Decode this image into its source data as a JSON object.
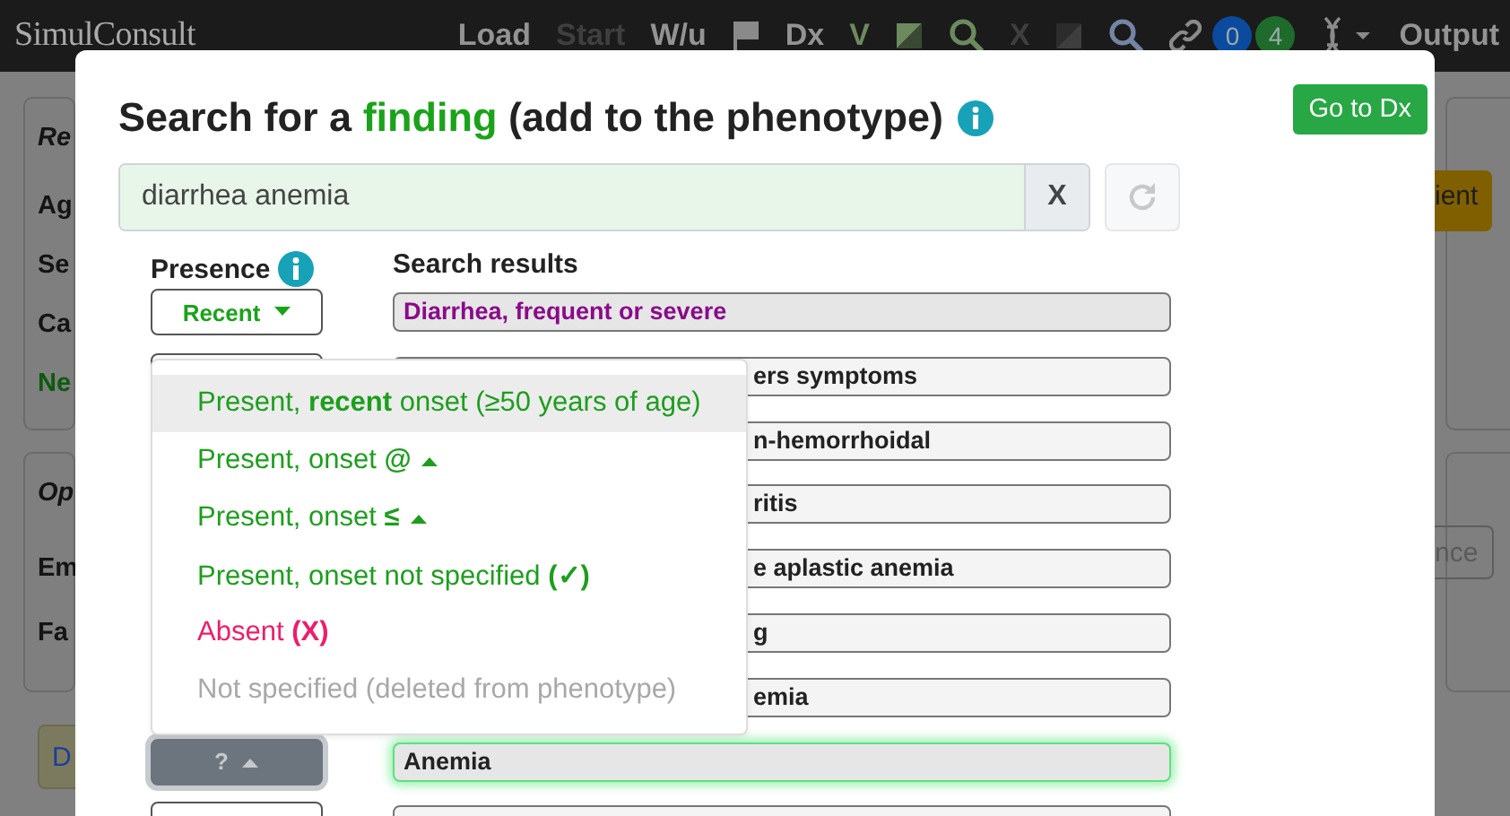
{
  "navbar": {
    "logo": "SimulConsult",
    "load": {
      "label": "Load",
      "disabled": false
    },
    "start": {
      "label": "Start",
      "disabled": true
    },
    "wu": {
      "label": "W/u",
      "disabled": false
    },
    "dx": {
      "label": "Dx",
      "disabled": false
    },
    "v": {
      "label": "V",
      "disabled": false
    },
    "x": {
      "label": "X",
      "disabled": true
    },
    "badges": [
      {
        "count": "0",
        "color": "#0b4a9e"
      },
      {
        "count": "4",
        "color": "#1e6b2b"
      }
    ],
    "output": "Output"
  },
  "left_strip": [
    {
      "kind": "panel",
      "lines": [
        {
          "text": "Re",
          "kind": "heading"
        },
        {
          "text": "Ag",
          "kind": "label"
        },
        {
          "text": "Se",
          "kind": "label"
        },
        {
          "text": "Ca",
          "kind": "label"
        },
        {
          "text": "Ne",
          "kind": "link"
        }
      ]
    },
    {
      "kind": "panel",
      "lines": [
        {
          "text": "Op",
          "kind": "heading"
        },
        {
          "text": "Em",
          "kind": "label"
        },
        {
          "text": "Fa",
          "kind": "label"
        }
      ]
    },
    {
      "kind": "button",
      "text": "D"
    }
  ],
  "right_strip": [
    {
      "kind": "panel",
      "button": {
        "text": "ient",
        "kind": "warning"
      }
    },
    {
      "kind": "panel",
      "button": {
        "text": "nce",
        "kind": "outline"
      }
    }
  ],
  "modal": {
    "title": "Search for a **finding** (add to the phenotype)",
    "go_button": "Go to Dx",
    "search": {
      "value": "diarrhea anemia",
      "clear": "X"
    },
    "presence_header": "Presence",
    "results_header": "Search results",
    "rows": [
      {
        "presence": {
          "kind": "set",
          "label": "Recent",
          "open": false
        },
        "result": "Diarrhea, frequent or severe",
        "in_phenotype": true,
        "focused": false,
        "covered": false
      },
      {
        "presence": {
          "kind": "blank"
        },
        "result": "ers symptoms",
        "in_phenotype": false,
        "focused": false,
        "covered": true
      },
      {
        "result": "n-hemorrhoidal",
        "in_phenotype": false,
        "focused": false,
        "covered": true
      },
      {
        "result": "ritis",
        "in_phenotype": false,
        "focused": false,
        "covered": true
      },
      {
        "result": "e aplastic anemia",
        "in_phenotype": false,
        "focused": false,
        "covered": true
      },
      {
        "result": "g",
        "in_phenotype": false,
        "focused": false,
        "covered": true
      },
      {
        "result": "emia",
        "in_phenotype": false,
        "focused": false,
        "covered": true
      },
      {
        "presence": {
          "kind": "unset",
          "label": "?",
          "open": true
        },
        "result": "Anemia",
        "in_phenotype": false,
        "focused": true,
        "covered": false
      },
      {
        "presence": {
          "kind": "blank"
        },
        "in_phenotype": false,
        "focused": false
      }
    ],
    "menu": [
      {
        "text": "Present, **recent** onset (≥50 years of age)",
        "kind": "present",
        "caret": false,
        "highlighted": true
      },
      {
        "text": "Present, onset **@**",
        "kind": "present",
        "caret": true,
        "highlighted": false
      },
      {
        "text": "Present, onset **≤**",
        "kind": "present",
        "caret": true,
        "highlighted": false
      },
      {
        "text": "Present, onset not specified **(✓)**",
        "kind": "present",
        "caret": false,
        "highlighted": false
      },
      {
        "text": "Absent **(X)**",
        "kind": "absent",
        "caret": false,
        "highlighted": false
      },
      {
        "text": "Not specified (deleted from phenotype)",
        "kind": "unset",
        "caret": false,
        "highlighted": false
      }
    ]
  }
}
